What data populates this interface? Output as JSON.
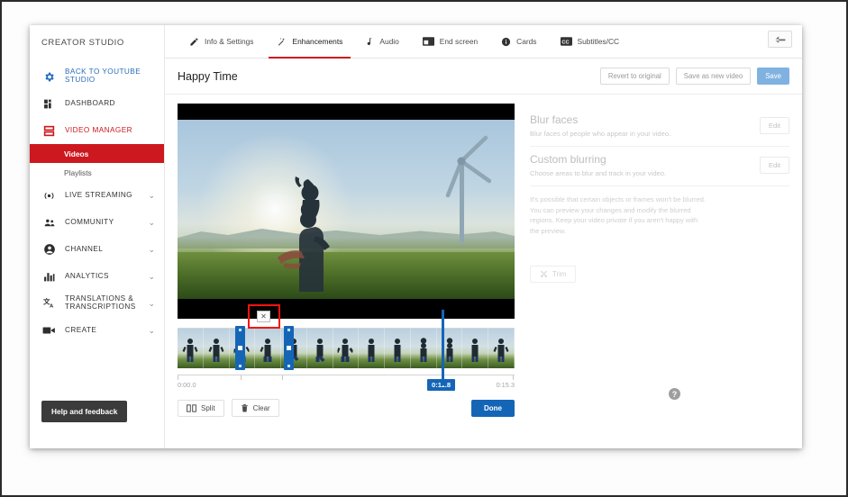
{
  "sidebar": {
    "studio_title": "CREATOR STUDIO",
    "items": [
      {
        "label": "BACK TO YOUTUBE STUDIO",
        "icon": "gear-icon",
        "style": "blue",
        "chevron": ""
      },
      {
        "label": "DASHBOARD",
        "icon": "dashboard-icon",
        "style": "plain",
        "chevron": ""
      },
      {
        "label": "VIDEO MANAGER",
        "icon": "video-manager-icon",
        "style": "red",
        "chevron": ""
      },
      {
        "label": "LIVE STREAMING",
        "icon": "live-stream-icon",
        "style": "plain",
        "chevron": "⌄"
      },
      {
        "label": "COMMUNITY",
        "icon": "community-icon",
        "style": "plain",
        "chevron": "⌄"
      },
      {
        "label": "CHANNEL",
        "icon": "channel-icon",
        "style": "plain",
        "chevron": "⌄"
      },
      {
        "label": "ANALYTICS",
        "icon": "analytics-icon",
        "style": "plain",
        "chevron": "⌄"
      },
      {
        "label": "TRANSLATIONS & TRANSCRIPTIONS",
        "icon": "translations-icon",
        "style": "plain",
        "chevron": "⌄"
      },
      {
        "label": "CREATE",
        "icon": "create-icon",
        "style": "plain",
        "chevron": "⌄"
      }
    ],
    "sub_items": [
      {
        "label": "Videos",
        "active": true
      },
      {
        "label": "Playlists",
        "active": false
      }
    ],
    "help_button": "Help and feedback",
    "active_color": "#cc181e",
    "link_color": "#2b6cb9"
  },
  "tabs": [
    {
      "label": "Info & Settings",
      "icon": "pencil-icon",
      "active": false
    },
    {
      "label": "Enhancements",
      "icon": "magic-wand-icon",
      "active": true
    },
    {
      "label": "Audio",
      "icon": "music-note-icon",
      "active": false
    },
    {
      "label": "End screen",
      "icon": "end-screen-icon",
      "active": false
    },
    {
      "label": "Cards",
      "icon": "info-circle-icon",
      "active": false
    },
    {
      "label": "Subtitles/CC",
      "icon": "cc-icon",
      "active": false
    }
  ],
  "header": {
    "video_title": "Happy Time",
    "revert_label": "Revert to original",
    "save_as_new_label": "Save as new video",
    "save_label": "Save",
    "back_icon": "back-arrow-icon",
    "save_color": "#7fb2e0"
  },
  "effects": {
    "blur_faces": {
      "title": "Blur faces",
      "description": "Blur faces of people who appear in your video.",
      "edit_label": "Edit"
    },
    "custom_blurring": {
      "title": "Custom blurring",
      "description": "Choose areas to blur and track in your video.",
      "edit_label": "Edit"
    },
    "note": "It's possible that certain objects or frames won't be blurred. You can preview your changes and modify the blurred regions. Keep your video private if you aren't happy with the preview.",
    "trim_label": "Trim",
    "trim_icon": "scissors-icon"
  },
  "timeline": {
    "start_time": "0:00.0",
    "end_time": "0:15.3",
    "playhead_time": "0:11.8",
    "playhead_color": "#1565b7",
    "highlight_color": "#f5150b",
    "delete_segment_icon": "close-x-icon",
    "help_icon": "question-mark-icon",
    "frame_count": 13,
    "selection": {
      "left_handle_label": "trim-start-handle",
      "right_handle_label": "trim-end-handle"
    }
  },
  "controls": {
    "split_label": "Split",
    "split_icon": "split-icon",
    "clear_label": "Clear",
    "clear_icon": "trash-icon",
    "done_label": "Done",
    "done_color": "#1565b7"
  }
}
